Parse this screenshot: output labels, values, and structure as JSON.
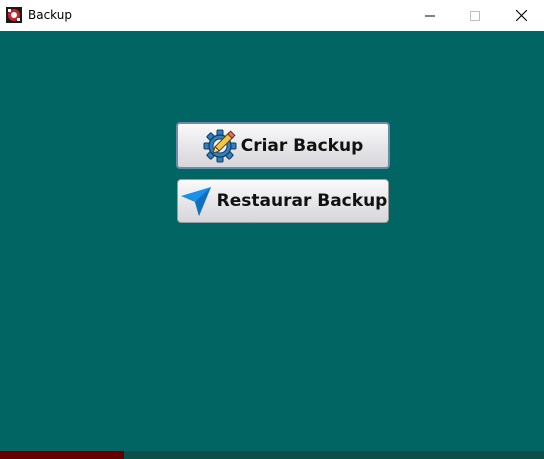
{
  "window": {
    "title": "Backup",
    "app_icon": "red-white-app-icon",
    "controls": [
      "minimize-icon",
      "maximize-icon",
      "close-icon"
    ]
  },
  "main": {
    "background_color": "#006563",
    "buttons": [
      {
        "label": "Criar Backup",
        "icon": "gear-pencil-icon",
        "focused": true
      },
      {
        "label": "Restaurar Backup",
        "icon": "blue-arrow-cursor-icon",
        "focused": false
      }
    ]
  }
}
